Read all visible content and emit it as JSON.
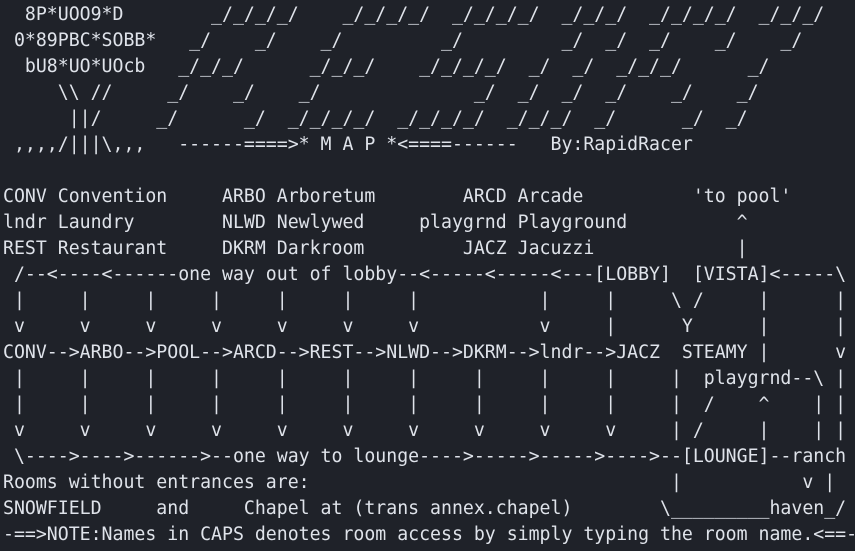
{
  "colors": {
    "background": "#1f2229",
    "foreground": "#dfe3ea"
  },
  "terminal": {
    "lines": [
      "  8P*UOO9*D        _/_/_/_/    _/_/_/_/  _/_/_/_/  _/_/_/  _/_/_/_/  _/_/_/",
      " 0*89PBC*SOBB*   _/    _/    _/         _/         _/  _/  _/    _/    _/",
      "  bU8*UO*UOcb   _/_/_/      _/_/_/    _/_/_/_/  _/  _/  _/_/_/      _/",
      "     \\\\ //     _/    _/    _/              _/  _/  _/  _/    _/    _/",
      "      ||/     _/      _/  _/_/_/_/  _/_/_/_/  _/_/_/  _/      _/  _/",
      " ,,,,/|||\\,,,   ------====>* M A P *<====------   By:RapidRacer",
      "",
      "CONV Convention     ARBO Arboretum        ARCD Arcade          'to pool'",
      "lndr Laundry        NLWD Newlywed     playgrnd Playground          ^",
      "REST Restaurant     DKRM Darkroom         JACZ Jacuzzi             |",
      " /--<----<------one way out of lobby--<-----<-----<---[LOBBY]  [VISTA]<-----\\",
      " |     |     |     |     |     |     |           |     |     \\ /     |      |",
      " v     v     v     v     v     v     v           v     |      Y      |      |",
      "CONV-->ARBO-->POOL-->ARCD-->REST-->NLWD-->DKRM-->lndr-->JACZ  STEAMY |      v      |",
      " |     |     |     |     |     |     |     |     |     |     |  playgrnd--\\ |",
      " |     |     |     |     |     |     |     |     |     |     |  /    ^    | |",
      " v     v     v     v     v     v     v     v     v     v     | /     |    | |",
      " \\---->---->------>--one way to lounge---->----->----->---->--[LOUNGE]--ranch | |",
      "Rooms without entrances are:                                 |           v |",
      "SNOWFIELD     and     Chapel at (trans annex.chapel)        \\_________haven_/",
      "-==>NOTE:Names in CAPS denotes room access by simply typing the room name.<==-"
    ]
  }
}
